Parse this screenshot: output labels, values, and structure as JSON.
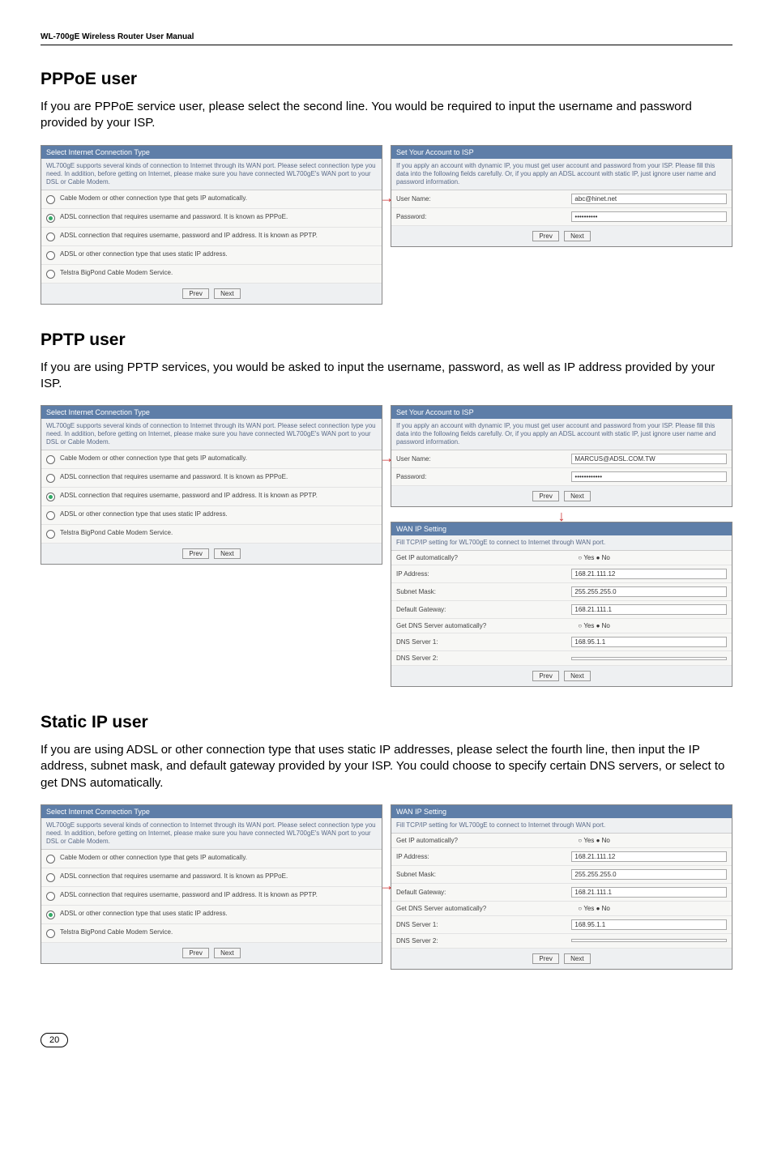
{
  "header": "WL-700gE Wireless Router User Manual",
  "s1": {
    "title": "PPPoE user",
    "desc": "If you are PPPoE service user, please select the second line. You would be required to input the username and password provided by your ISP.",
    "left": {
      "head": "Select Internet Connection Type",
      "intro": "WL700gE supports several kinds of connection to Internet through its WAN port. Please select connection type you need. In addition, before getting on Internet, please make sure you have connected WL700gE's WAN port to your DSL or Cable Modem.",
      "r1": "Cable Modem or other connection type that gets IP automatically.",
      "r2": "ADSL connection that requires username and password. It is known as PPPoE.",
      "r3": "ADSL connection that requires username, password and IP address. It is known as PPTP.",
      "r4": "ADSL or other connection type that uses static IP address.",
      "r5": "Telstra BigPond Cable Modem Service.",
      "prev": "Prev",
      "next": "Next"
    },
    "right": {
      "head": "Set Your Account to ISP",
      "intro": "If you apply an account with dynamic IP, you must get user account and password from your ISP. Please fill this data into the following fields carefully. Or, if you apply an ADSL account with static IP, just ignore user name and password information.",
      "l_user": "User Name:",
      "v_user": "abc@hinet.net",
      "l_pass": "Password:",
      "v_pass": "••••••••••",
      "prev": "Prev",
      "next": "Next"
    }
  },
  "s2": {
    "title": "PPTP user",
    "desc": "If you are using PPTP services, you would be asked to input the username, password, as well as IP address provided by your ISP.",
    "left": {
      "head": "Select Internet Connection Type",
      "intro": "WL700gE supports several kinds of connection to Internet through its WAN port. Please select connection type you need. In addition, before getting on Internet, please make sure you have connected WL700gE's WAN port to your DSL or Cable Modem.",
      "r1": "Cable Modem or other connection type that gets IP automatically.",
      "r2": "ADSL connection that requires username and password. It is known as PPPoE.",
      "r3": "ADSL connection that requires username, password and IP address. It is known as PPTP.",
      "r4": "ADSL or other connection type that uses static IP address.",
      "r5": "Telstra BigPond Cable Modem Service.",
      "prev": "Prev",
      "next": "Next"
    },
    "rt": {
      "head": "Set Your Account to ISP",
      "intro": "If you apply an account with dynamic IP, you must get user account and password from your ISP. Please fill this data into the following fields carefully. Or, if you apply an ADSL account with static IP, just ignore user name and password information.",
      "l_user": "User Name:",
      "v_user": "MARCUS@ADSL.COM.TW",
      "l_pass": "Password:",
      "v_pass": "••••••••••••",
      "prev": "Prev",
      "next": "Next"
    },
    "rb": {
      "head": "WAN IP Setting",
      "intro": "Fill TCP/IP setting for WL700gE to connect to Internet through WAN port.",
      "l_auto": "Get IP automatically?",
      "v_auto": "○ Yes ● No",
      "l_ip": "IP Address:",
      "v_ip": "168.21.111.12",
      "l_mask": "Subnet Mask:",
      "v_mask": "255.255.255.0",
      "l_gw": "Default Gateway:",
      "v_gw": "168.21.111.1",
      "l_dns": "Get DNS Server automatically?",
      "v_dns": "○ Yes ● No",
      "l_d1": "DNS Server 1:",
      "v_d1": "168.95.1.1",
      "l_d2": "DNS Server 2:",
      "v_d2": "",
      "prev": "Prev",
      "next": "Next"
    }
  },
  "s3": {
    "title": "Static IP user",
    "desc": "If you are using ADSL or other connection type that uses static IP addresses, please select the fourth line, then input the IP address, subnet mask, and default gateway provided by your ISP. You could choose to specify certain DNS servers, or select to get DNS automatically.",
    "left": {
      "head": "Select Internet Connection Type",
      "intro": "WL700gE supports several kinds of connection to Internet through its WAN port. Please select connection type you need. In addition, before getting on Internet, please make sure you have connected WL700gE's WAN port to your DSL or Cable Modem.",
      "r1": "Cable Modem or other connection type that gets IP automatically.",
      "r2": "ADSL connection that requires username and password. It is known as PPPoE.",
      "r3": "ADSL connection that requires username, password and IP address. It is known as PPTP.",
      "r4": "ADSL or other connection type that uses static IP address.",
      "r5": "Telstra BigPond Cable Modem Service.",
      "prev": "Prev",
      "next": "Next"
    },
    "right": {
      "head": "WAN IP Setting",
      "intro": "Fill TCP/IP setting for WL700gE to connect to Internet through WAN port.",
      "l_auto": "Get IP automatically?",
      "v_auto": "○ Yes ● No",
      "l_ip": "IP Address:",
      "v_ip": "168.21.111.12",
      "l_mask": "Subnet Mask:",
      "v_mask": "255.255.255.0",
      "l_gw": "Default Gateway:",
      "v_gw": "168.21.111.1",
      "l_dns": "Get DNS Server automatically?",
      "v_dns": "○ Yes ● No",
      "l_d1": "DNS Server 1:",
      "v_d1": "168.95.1.1",
      "l_d2": "DNS Server 2:",
      "v_d2": "",
      "prev": "Prev",
      "next": "Next"
    }
  },
  "page": "20"
}
